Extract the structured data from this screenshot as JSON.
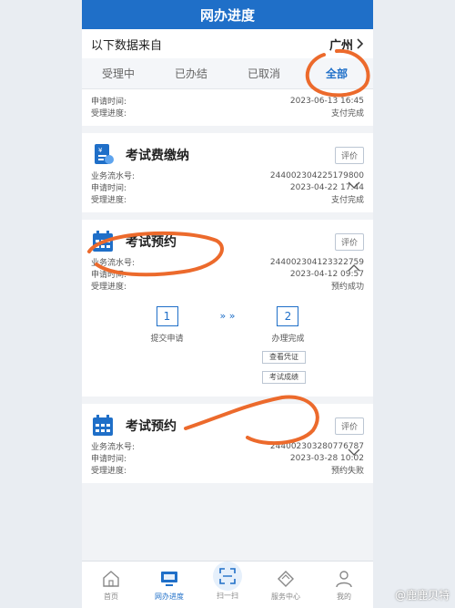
{
  "header": {
    "title": "网办进度"
  },
  "source": {
    "label": "以下数据来自",
    "city": "广州"
  },
  "tabs": [
    {
      "label": "受理中"
    },
    {
      "label": "已办结"
    },
    {
      "label": "已取消"
    },
    {
      "label": "全部",
      "active": true
    }
  ],
  "partial_card": {
    "rows": [
      {
        "k": "申请时间:",
        "v": "2023-06-13 16:45"
      },
      {
        "k": "受理进度:",
        "v": "支付完成"
      }
    ]
  },
  "cards": [
    {
      "title": "考试费缴纳",
      "rate": "评价",
      "rows": [
        {
          "k": "业务流水号:",
          "v": "244002304225179800"
        },
        {
          "k": "申请时间:",
          "v": "2023-04-22 17:44"
        },
        {
          "k": "受理进度:",
          "v": "支付完成"
        }
      ]
    },
    {
      "title": "考试预约",
      "rate": "评价",
      "rows": [
        {
          "k": "业务流水号:",
          "v": "244002304123322759"
        },
        {
          "k": "申请时间:",
          "v": "2023-04-12 09:57"
        },
        {
          "k": "受理进度:",
          "v": "预约成功"
        }
      ],
      "steps": [
        {
          "num": "1",
          "label": "提交申请"
        },
        {
          "num": "2",
          "label": "办理完成"
        }
      ],
      "step_arrow": "» »",
      "actions": [
        "查看凭证",
        "考试成绩"
      ]
    },
    {
      "title": "考试预约",
      "rate": "评价",
      "rows": [
        {
          "k": "业务流水号:",
          "v": "244002303280776787"
        },
        {
          "k": "申请时间:",
          "v": "2023-03-28 10:02"
        },
        {
          "k": "受理进度:",
          "v": "预约失败"
        }
      ]
    }
  ],
  "bottom_nav": [
    {
      "label": "首页",
      "icon": "home-icon"
    },
    {
      "label": "网办进度",
      "icon": "monitor-icon",
      "active": true
    },
    {
      "label": "扫一扫",
      "icon": "scan-icon"
    },
    {
      "label": "服务中心",
      "icon": "service-icon"
    },
    {
      "label": "我的",
      "icon": "user-icon"
    }
  ],
  "watermark": "@鹿鹿贝特",
  "colors": {
    "primary": "#1f6fc8",
    "annotation": "#ec6a2c"
  }
}
